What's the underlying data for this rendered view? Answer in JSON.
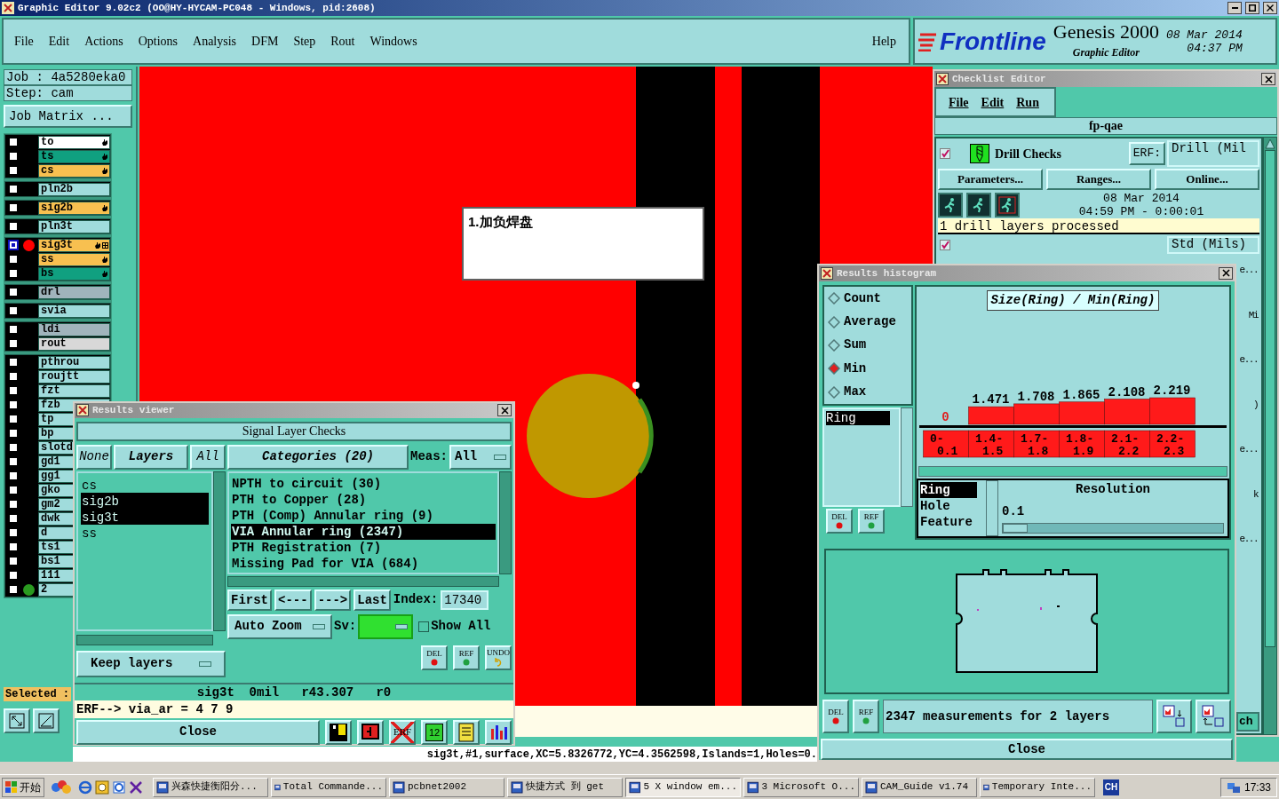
{
  "window": {
    "title": "Graphic Editor 9.02c2  (OO@HY-HYCAM-PC048 - Windows, pid:2608)"
  },
  "menu": [
    "File",
    "Edit",
    "Actions",
    "Options",
    "Analysis",
    "DFM",
    "Step",
    "Rout",
    "Windows"
  ],
  "help": "Help",
  "brand": {
    "logo": "Frontline",
    "product": "Genesis 2000",
    "subtitle": "Graphic Editor",
    "date": "08 Mar 2014",
    "time": "04:37 PM"
  },
  "job": "Job : 4a5280eka0",
  "step": "Step: cam",
  "job_matrix": "Job Matrix ...",
  "layer_groups": [
    [
      {
        "name": "to",
        "color": "#ffffff",
        "editable": true,
        "selected": false
      },
      {
        "name": "ts",
        "color": "#10a080",
        "editable": true,
        "selected": false
      },
      {
        "name": "cs",
        "color": "#f8c050",
        "editable": true,
        "selected": false
      }
    ],
    [
      {
        "name": "pln2b",
        "color": "#a0dcdc",
        "editable": false,
        "selected": false
      }
    ],
    [
      {
        "name": "sig2b",
        "color": "#f8c050",
        "editable": true,
        "selected": false
      }
    ],
    [
      {
        "name": "pln3t",
        "color": "#a0dcdc",
        "editable": false,
        "selected": false
      }
    ],
    [
      {
        "name": "sig3t",
        "color": "#f8c050",
        "editable": true,
        "selected": true,
        "dot": {
          "color": "#ff0000"
        }
      },
      {
        "name": "ss",
        "color": "#f8c050",
        "editable": true,
        "selected": false
      },
      {
        "name": "bs",
        "color": "#10a080",
        "editable": true,
        "selected": false
      }
    ],
    [
      {
        "name": "drl",
        "color": "#a0b4bc",
        "editable": false,
        "selected": false
      }
    ],
    [
      {
        "name": "svia",
        "color": "#a0dcdc",
        "editable": false,
        "selected": false
      }
    ],
    [
      {
        "name": "ldi",
        "color": "#a0b4bc",
        "editable": false,
        "selected": false
      },
      {
        "name": "rout",
        "color": "#d8d8d8",
        "editable": false,
        "selected": false
      }
    ],
    [
      {
        "name": "pthrou",
        "color": "#a0dcdc",
        "editable": false,
        "selected": false
      },
      {
        "name": "roujtt",
        "color": "#a0dcdc",
        "editable": false,
        "selected": false
      },
      {
        "name": "fzt",
        "color": "#a0dcdc",
        "editable": false,
        "selected": false
      },
      {
        "name": "fzb",
        "color": "#a0dcdc",
        "editable": false,
        "selected": false
      },
      {
        "name": "tp",
        "color": "#a0dcdc",
        "editable": false,
        "selected": false
      },
      {
        "name": "bp",
        "color": "#a0dcdc",
        "editable": false,
        "selected": false
      },
      {
        "name": "slotd",
        "color": "#a0dcdc",
        "editable": false,
        "selected": false
      },
      {
        "name": "gd1",
        "color": "#a0dcdc",
        "editable": false,
        "selected": false
      },
      {
        "name": "gg1",
        "color": "#a0dcdc",
        "editable": false,
        "selected": false
      },
      {
        "name": "gko",
        "color": "#a0dcdc",
        "editable": false,
        "selected": false
      },
      {
        "name": "gm2",
        "color": "#a0dcdc",
        "editable": false,
        "selected": false
      },
      {
        "name": "dwk",
        "color": "#a0dcdc",
        "editable": false,
        "selected": false
      },
      {
        "name": "d",
        "color": "#a0dcdc",
        "editable": false,
        "selected": false
      },
      {
        "name": "ts1",
        "color": "#a0dcdc",
        "editable": false,
        "selected": false
      },
      {
        "name": "bs1",
        "color": "#a0dcdc",
        "editable": false,
        "selected": false
      },
      {
        "name": "111",
        "color": "#a0dcdc",
        "editable": false,
        "selected": false
      },
      {
        "name": "2",
        "color": "#a0dcdc",
        "editable": false,
        "selected": false,
        "dot": {
          "color": "#2a9a20"
        }
      }
    ]
  ],
  "selected_label": "Selected :",
  "canvas": {
    "note": "1.加负焊盘",
    "status": "sig3t,#1,surface,XC=5.8326772,YC=4.3562598,Islands=1,Holes=0."
  },
  "results_viewer": {
    "title": "Results viewer",
    "header": "Signal Layer Checks",
    "layer_buttons": [
      "None",
      "Layers",
      "All"
    ],
    "layers": [
      {
        "name": "cs",
        "selected": false
      },
      {
        "name": "sig2b",
        "selected": true
      },
      {
        "name": "sig3t",
        "selected": true
      },
      {
        "name": "ss",
        "selected": false
      }
    ],
    "keep": "Keep layers",
    "categories_header": "Categories (20)",
    "meas_label": "Meas:",
    "meas_value": "All",
    "categories": [
      {
        "name": "NPTH to circuit (30)",
        "selected": false
      },
      {
        "name": "PTH to Copper (28)",
        "selected": false
      },
      {
        "name": "PTH (Comp) Annular ring (9)",
        "selected": false
      },
      {
        "name": "VIA Annular ring (2347)",
        "selected": true
      },
      {
        "name": "PTH Registration (7)",
        "selected": false
      },
      {
        "name": "Missing Pad for VIA (684)",
        "selected": false
      }
    ],
    "nav": [
      "First",
      "<---",
      "--->",
      "Last"
    ],
    "index_label": "Index:",
    "index_value": "17340",
    "zoom": "Auto Zoom",
    "sv_label": "Sv:",
    "show_all": {
      "label": "Show All",
      "checked": false
    },
    "tools": [
      "DEL",
      "REF",
      "UNDO"
    ],
    "bottom_tools": [
      "ERF",
      "12"
    ],
    "info": "sig3t  0mil   r43.307   r0",
    "erf": "ERF--> via_ar = 4 7 9",
    "close": "Close"
  },
  "checklist_editor": {
    "title": "Checklist Editor",
    "menu": [
      "File",
      "Edit",
      "Run"
    ],
    "name": "fp-qae",
    "check": {
      "name": "Drill Checks",
      "checked": true,
      "erf_label": "ERF:",
      "erf_value": "Drill (Mil",
      "buttons": [
        "Parameters...",
        "Ranges...",
        "Online..."
      ],
      "date": "08 Mar 2014",
      "time": "04:59 PM - 0:00:01",
      "message": "1 drill layers processed"
    },
    "check2": {
      "checked": true,
      "erf_value": "Std (Mils)"
    },
    "fragments": [
      "e...",
      "Mi",
      "e...",
      ")",
      "e...",
      "k",
      "e..."
    ],
    "dropdown_fragment": "ch"
  },
  "histogram": {
    "title": "Results histogram",
    "modes": [
      {
        "label": "Count",
        "selected": false
      },
      {
        "label": "Average",
        "selected": false
      },
      {
        "label": "Sum",
        "selected": false
      },
      {
        "label": "Min",
        "selected": true
      },
      {
        "label": "Max",
        "selected": false
      }
    ],
    "lists": [
      {
        "name": "Ring",
        "selected": true
      }
    ],
    "list_tools": [
      "DEL",
      "REF"
    ],
    "bottom_tools": [
      "DEL",
      "REF"
    ],
    "chart_data": {
      "type": "bar",
      "title": "Size(Ring) / Min(Ring)",
      "categories": [
        "0-0.1",
        "1.4-1.5",
        "1.7-1.8",
        "1.8-1.9",
        "2.1-2.2",
        "2.2-2.3"
      ],
      "values": [
        0,
        1.471,
        1.708,
        1.865,
        2.108,
        2.219
      ],
      "data_labels": true
    },
    "attributes": [
      {
        "name": "Ring",
        "selected": true
      },
      {
        "name": "Hole",
        "selected": false
      },
      {
        "name": "Feature",
        "selected": false
      }
    ],
    "resolution_label": "Resolution",
    "resolution_value": "0.1",
    "resolution_slider": {
      "level": 0.07
    },
    "message": "2347 measurements for 2 layers",
    "close": "Close"
  },
  "taskbar": {
    "start": "开始",
    "tasks": [
      {
        "label": "兴森快捷衡阳分...",
        "selected": false
      },
      {
        "label": "Total Commande...",
        "selected": false
      },
      {
        "label": "pcbnet2002",
        "selected": false
      },
      {
        "label": "快捷方式 到 get",
        "selected": false
      },
      {
        "label": "5 X window em...",
        "selected": true
      },
      {
        "label": "3 Microsoft O...",
        "selected": false
      },
      {
        "label": "CAM_Guide v1.74",
        "selected": false
      },
      {
        "label": "Temporary Inte...",
        "selected": false
      }
    ],
    "lang": "CH",
    "clock": "17:33"
  }
}
